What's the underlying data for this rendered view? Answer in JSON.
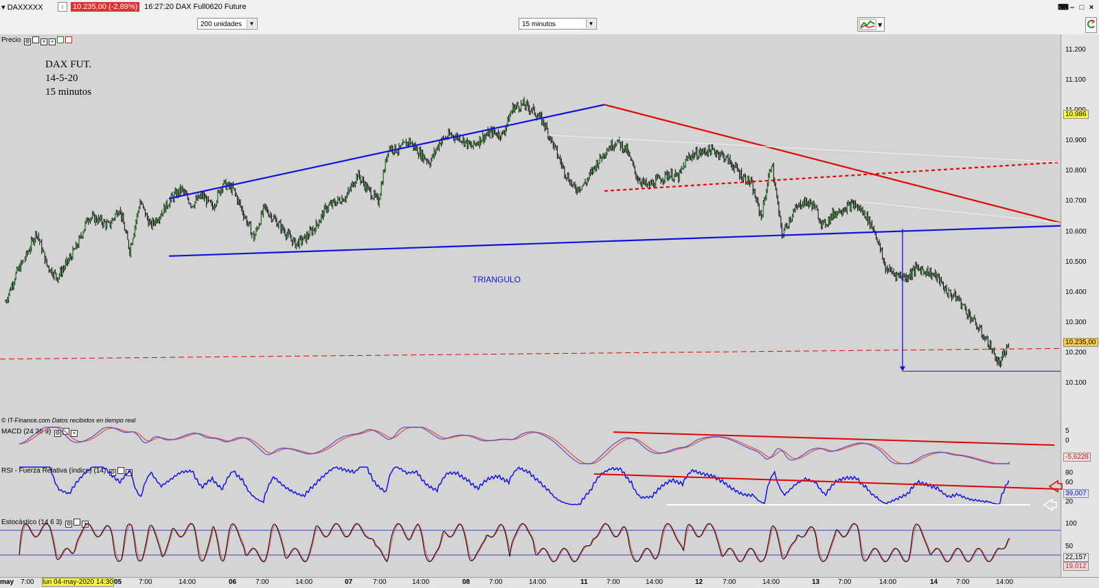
{
  "header": {
    "symbol": "DAXXXXX",
    "info": "i",
    "price_change": "10.235,00 (-2,89%)",
    "time_title": "16:27:20 DAX Full0620 Future"
  },
  "toolbar": {
    "units": "200 unidades",
    "timeframe": "15 minutos"
  },
  "price_panel": {
    "label": "Precio",
    "note_line1": "DAX FUT.",
    "note_line2": "14-5-20",
    "note_line3": "15 minutos",
    "pattern_label": "TRIANGULO",
    "source": "© IT-Finance.com",
    "source_note": "Datos recibidos en tiempo real",
    "ticks": [
      "11.200",
      "11.100",
      "11.000",
      "10.900",
      "10.800",
      "10.700",
      "10.600",
      "10.500",
      "10.400",
      "10.300",
      "10.200",
      "10.100"
    ],
    "badge_high": "10.986",
    "badge_last": "10.235,00"
  },
  "macd_panel": {
    "label": "MACD (24 26 9)",
    "ticks": [
      "5",
      "0"
    ],
    "badge": "-5,6228"
  },
  "rsi_panel": {
    "label": "RSI - Fuerza Relativa (índice) (14)",
    "ticks": [
      "80",
      "60",
      "40",
      "20"
    ],
    "badge": "39,007"
  },
  "stoch_panel": {
    "label": "Estocástico (14 6 3)",
    "ticks": [
      "100",
      "50"
    ],
    "badge_k": "22,157",
    "badge_d": "19,012"
  },
  "xaxis": {
    "first": "may",
    "highlight": "lun 04-may-2020 14:30",
    "labels": [
      {
        "t": "7:00",
        "b": false
      },
      {
        "t": "05",
        "b": true
      },
      {
        "t": "7:00",
        "b": false
      },
      {
        "t": "14:00",
        "b": false
      },
      {
        "t": "06",
        "b": true
      },
      {
        "t": "7:00",
        "b": false
      },
      {
        "t": "14:00",
        "b": false
      },
      {
        "t": "07",
        "b": true
      },
      {
        "t": "7:00",
        "b": false
      },
      {
        "t": "14:00",
        "b": false
      },
      {
        "t": "08",
        "b": true
      },
      {
        "t": "7:00",
        "b": false
      },
      {
        "t": "14:00",
        "b": false
      },
      {
        "t": "11",
        "b": true
      },
      {
        "t": "7:00",
        "b": false
      },
      {
        "t": "14:00",
        "b": false
      },
      {
        "t": "12",
        "b": true
      },
      {
        "t": "7:00",
        "b": false
      },
      {
        "t": "14:00",
        "b": false
      },
      {
        "t": "13",
        "b": true
      },
      {
        "t": "7:00",
        "b": false
      },
      {
        "t": "14:00",
        "b": false
      },
      {
        "t": "14",
        "b": true
      },
      {
        "t": "7:00",
        "b": false
      },
      {
        "t": "14:00",
        "b": false
      }
    ]
  },
  "chart_data": {
    "type": "line",
    "title": "DAX Full0620 Future",
    "ylim": [
      10060,
      11260
    ],
    "y_ticks": [
      11200,
      11100,
      11000,
      10900,
      10800,
      10700,
      10600,
      10500,
      10400,
      10300,
      10200,
      10100
    ],
    "x_sessions": [
      "04",
      "05",
      "06",
      "07",
      "08",
      "11",
      "12",
      "13",
      "14"
    ],
    "series": [
      {
        "values": [
          10370,
          10460,
          10520,
          10600,
          10490,
          10450,
          10500,
          10560,
          10650,
          10640,
          10620,
          10680,
          10540,
          10700,
          10620,
          10660,
          10710,
          10740,
          10690,
          10720,
          10680,
          10760,
          10740,
          10660,
          10580,
          10680,
          10640,
          10600,
          10560,
          10580,
          10620,
          10680,
          10700,
          10720,
          10790,
          10740,
          10700,
          10880,
          10870,
          10900,
          10860,
          10830,
          10900,
          10920,
          10910,
          10880,
          10910,
          10930,
          10920,
          11010,
          11020,
          11000,
          10960,
          10880,
          10800,
          10740,
          10760,
          10820,
          10870,
          10900,
          10870,
          10780,
          10750,
          10770,
          10790,
          10780,
          10850,
          10860,
          10870,
          10860,
          10830,
          10790,
          10760,
          10650,
          10830,
          10590,
          10660,
          10700,
          10690,
          10620,
          10660,
          10680,
          10690,
          10660,
          10600,
          10480,
          10460,
          10450,
          10480,
          10470,
          10450,
          10400,
          10380,
          10330,
          10280,
          10230,
          10160,
          10235
        ]
      }
    ],
    "annotations": [
      {
        "type": "line",
        "role": "upper triangle side",
        "color": "#1010e0",
        "from": [
          "05",
          10710
        ],
        "to": [
          "11",
          11020
        ]
      },
      {
        "type": "line",
        "role": "lower triangle side",
        "color": "#1010e0",
        "from": [
          "05",
          10520
        ],
        "to": [
          "14 end",
          10620
        ]
      },
      {
        "type": "line",
        "role": "descending resistance",
        "color": "#e00000",
        "from": [
          "11",
          11020
        ],
        "to": [
          "14 end",
          10630
        ]
      },
      {
        "type": "line",
        "role": "support",
        "color": "#e00000",
        "style": "dashed",
        "from": [
          "11",
          10735
        ],
        "to": [
          "14 end",
          10830
        ]
      },
      {
        "type": "hline",
        "role": "last price",
        "color": "#e00000",
        "style": "dashed",
        "value": 10235
      },
      {
        "type": "arrow",
        "role": "projected target",
        "color": "#1010e0",
        "from": 10610,
        "to": 10140
      }
    ]
  },
  "colors": {
    "price_bars": "#000000",
    "trend_blue": "#1010e0",
    "trend_red": "#e00000",
    "background": "#d4d4d4"
  }
}
